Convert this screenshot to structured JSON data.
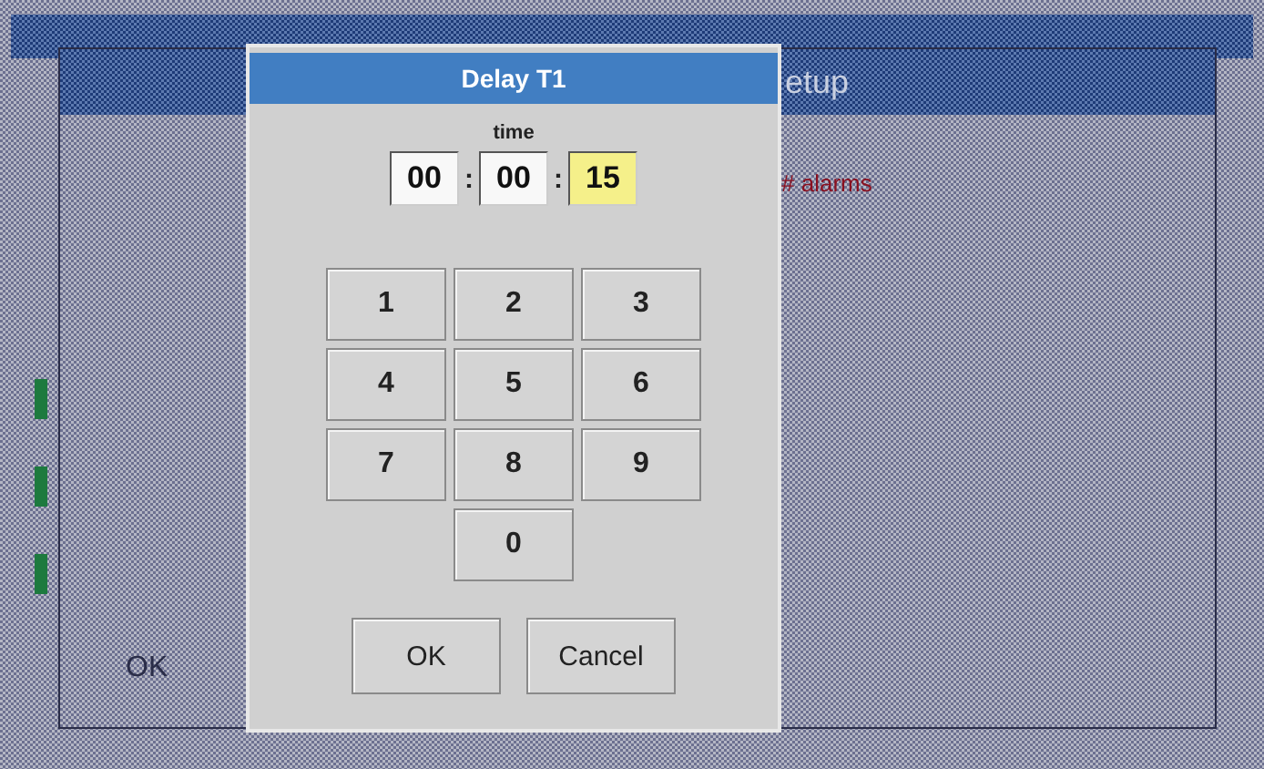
{
  "background": {
    "header": "etup",
    "alarm_label": "# alarms",
    "ok_button": "OK"
  },
  "dialog": {
    "title": "Delay T1",
    "time_label": "time",
    "fields": [
      {
        "value": "00",
        "selected": false,
        "separator": ":"
      },
      {
        "value": "00",
        "selected": false,
        "separator": ":"
      },
      {
        "value": "15",
        "selected": true
      }
    ],
    "keys": [
      "1",
      "2",
      "3",
      "4",
      "5",
      "6",
      "7",
      "8",
      "9",
      "0"
    ],
    "buttons": [
      "OK",
      "Cancel"
    ]
  }
}
